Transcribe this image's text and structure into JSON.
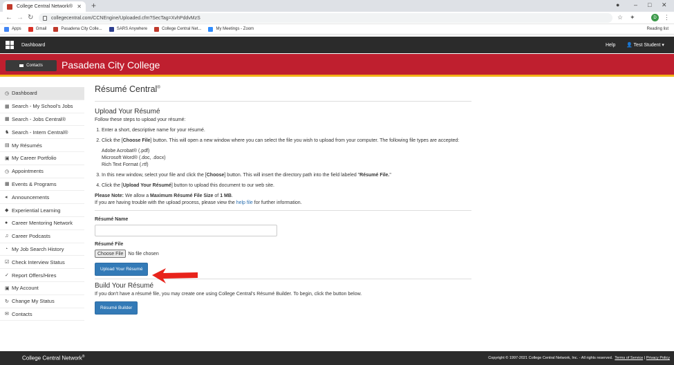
{
  "browser": {
    "tab_title": "College Central Network®",
    "url": "collegecentral.com/CCNEngine/Uploaded.cfm?SecTag=XvhPddvMzS",
    "bookmarks": [
      {
        "label": "Apps",
        "icon": "apps-grid-icon",
        "color": "#4285f4"
      },
      {
        "label": "Gmail",
        "icon": "gmail-icon",
        "color": "#d93025"
      },
      {
        "label": "Pasadena City Colle...",
        "icon": "pcc-icon",
        "color": "#c0392b"
      },
      {
        "label": "SARS Anywhere",
        "icon": "sars-icon",
        "color": "#2c3e8f"
      },
      {
        "label": "College Central Net...",
        "icon": "ccn-icon",
        "color": "#c0392b"
      },
      {
        "label": "My Meetings - Zoom",
        "icon": "zoom-icon",
        "color": "#2d8cff"
      }
    ],
    "reading_list": "Reading list",
    "profile_initial": "D"
  },
  "topnav": {
    "dashboard": "Dashboard",
    "help": "Help",
    "user": "Test Student"
  },
  "banner": {
    "contacts_button": "Contacts",
    "college_name": "Pasadena City College",
    "brand_color": "#bf1f2f"
  },
  "sidebar": {
    "items": [
      {
        "label": "Dashboard",
        "icon": "dashboard-icon",
        "glyph": "◷"
      },
      {
        "label": "Search - My School's Jobs",
        "icon": "search-icon",
        "glyph": "▦"
      },
      {
        "label": "Search - Jobs Central®",
        "icon": "search-icon",
        "glyph": "▦"
      },
      {
        "label": "Search - Intern Central®",
        "icon": "intern-icon",
        "glyph": "♞"
      },
      {
        "label": "My Résumés",
        "icon": "document-icon",
        "glyph": "▤"
      },
      {
        "label": "My Career Portfolio",
        "icon": "portfolio-icon",
        "glyph": "▣"
      },
      {
        "label": "Appointments",
        "icon": "clock-icon",
        "glyph": "◷"
      },
      {
        "label": "Events & Programs",
        "icon": "calendar-icon",
        "glyph": "▦"
      },
      {
        "label": "Announcements",
        "icon": "megaphone-icon",
        "glyph": "◂"
      },
      {
        "label": "Experiential Learning",
        "icon": "graduation-cap-icon",
        "glyph": "◆"
      },
      {
        "label": "Career Mentoring Network",
        "icon": "user-icon",
        "glyph": "●"
      },
      {
        "label": "Career Podcasts",
        "icon": "headphones-icon",
        "glyph": "♫"
      },
      {
        "label": "My Job Search History",
        "icon": "history-icon",
        "glyph": "◔"
      },
      {
        "label": "Check Interview Status",
        "icon": "checkbox-icon",
        "glyph": "☑"
      },
      {
        "label": "Report Offers/Hires",
        "icon": "thumbs-up-icon",
        "glyph": "✓"
      },
      {
        "label": "My Account",
        "icon": "account-icon",
        "glyph": "▣"
      },
      {
        "label": "Change My Status",
        "icon": "refresh-icon",
        "glyph": "↻"
      },
      {
        "label": "Contacts",
        "icon": "envelope-icon",
        "glyph": "✉"
      }
    ]
  },
  "main": {
    "title": "Résumé Central",
    "upload_heading": "Upload Your Résumé",
    "intro": "Follow these steps to upload your résumé:",
    "step1": "Enter a short, descriptive name for your résumé.",
    "step2_a": "Click the [",
    "step2_b": "Choose File",
    "step2_c": "] button. This will open a new window where you can select the file you wish to upload from your computer. The following file types are accepted:",
    "filetype1": "Adobe Acrobat® (.pdf)",
    "filetype2": "Microsoft Word® (.doc, .docx)",
    "filetype3": "Rich Text Format (.rtf)",
    "step3_a": "In this new window, select your file and click the [",
    "step3_b": "Choose",
    "step3_c": "] button. This will insert the directory path into the field labeled \"",
    "step3_d": "Résumé File.",
    "step3_e": "\"",
    "step4_a": "Click the [",
    "step4_b": "Upload Your Résumé",
    "step4_c": "] button to upload this document to our web site.",
    "note_label": "Please Note:",
    "note_a": " We allow a ",
    "note_b": "Maximum Résumé File Size",
    "note_c": " of ",
    "note_d": "1 MB",
    "note_e": ".",
    "trouble_a": "If you are having trouble with the upload process, please view the ",
    "trouble_link": "help file",
    "trouble_b": " for further information.",
    "name_label": "Résumé Name",
    "name_value": "",
    "file_label": "Résumé File",
    "choose_file": "Choose File",
    "no_file": "No file chosen",
    "upload_button": "Upload Your Résumé",
    "build_heading": "Build Your Résumé",
    "build_text": "If you don't have a résumé file, you may create one using College Central's Résumé Builder. To begin, click the button below.",
    "builder_button": "Résumé Builder"
  },
  "footer": {
    "brand": "College Central Network",
    "copyright": "Copyright © 1997-2021 College Central Network, Inc. - All rights reserved.",
    "terms": "Terms of Service",
    "separator": "|",
    "privacy": "Privacy Policy"
  }
}
